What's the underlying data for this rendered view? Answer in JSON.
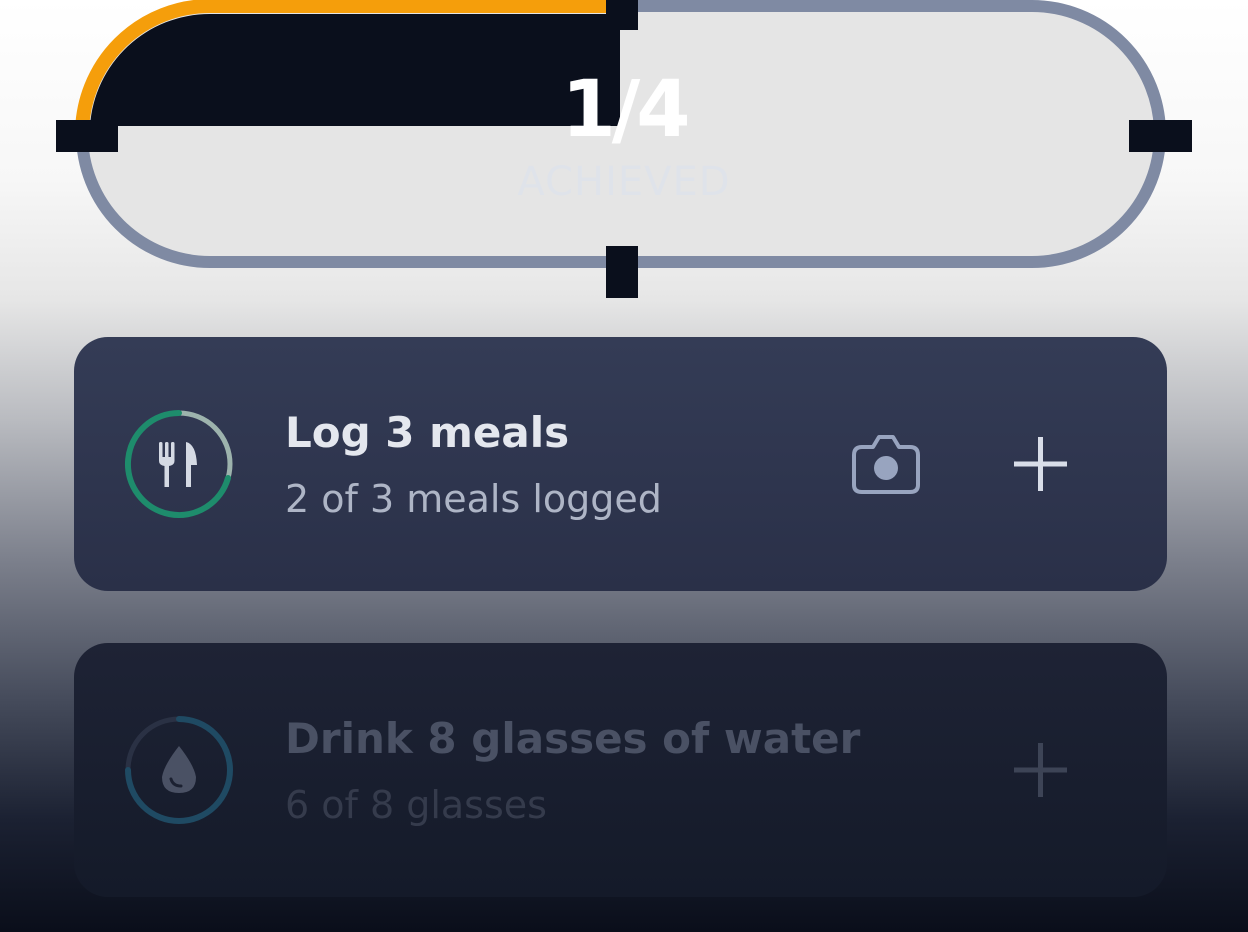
{
  "progress": {
    "count": "1/4",
    "label": "ACHIEVED",
    "fraction_achieved": 0.25,
    "colors": {
      "achieved": "#f59e0b",
      "track": "#7f8aa3"
    }
  },
  "goals": [
    {
      "title": "Log 3 meals",
      "subtitle": "2 of 3 meals logged",
      "icon": "fork-knife-icon",
      "progress": 0.67,
      "ring_color": "#1e8c6c",
      "actions": [
        "camera-icon",
        "plus-icon"
      ]
    },
    {
      "title": "Drink 8 glasses of water",
      "subtitle": "6 of 8 glasses",
      "icon": "water-drop-icon",
      "progress": 0.75,
      "ring_color": "#1f4a63",
      "actions": [
        "plus-icon"
      ]
    }
  ]
}
